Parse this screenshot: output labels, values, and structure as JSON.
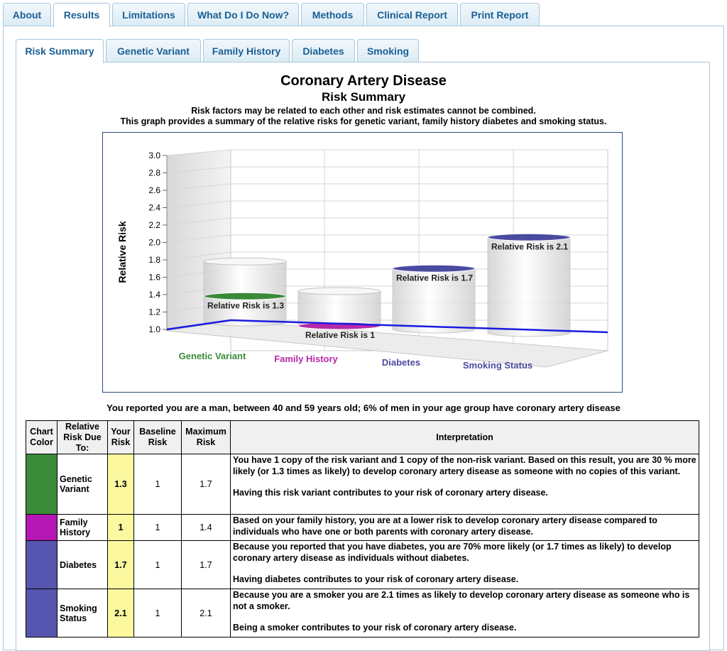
{
  "top_tabs": [
    {
      "label": "About"
    },
    {
      "label": "Results"
    },
    {
      "label": "Limitations"
    },
    {
      "label": "What Do I Do Now?"
    },
    {
      "label": "Methods"
    },
    {
      "label": "Clinical Report"
    },
    {
      "label": "Print Report"
    }
  ],
  "sub_tabs": [
    {
      "label": "Risk Summary"
    },
    {
      "label": "Genetic Variant"
    },
    {
      "label": "Family History"
    },
    {
      "label": "Diabetes"
    },
    {
      "label": "Smoking"
    }
  ],
  "header": {
    "title": "Coronary Artery Disease",
    "subtitle": "Risk Summary",
    "note1": "Risk factors may be related to each other and risk estimates cannot be combined.",
    "note2": "This graph provides a summary of the relative risks for genetic variant, family history diabetes and smoking status."
  },
  "chart_data": {
    "type": "bar",
    "ylabel": "Relative Risk",
    "ylim": [
      1.0,
      3.0
    ],
    "yticks": [
      "3.0",
      "2.8",
      "2.6",
      "2.4",
      "2.2",
      "2.0",
      "1.8",
      "1.6",
      "1.4",
      "1.2",
      "1.0"
    ],
    "baseline": 1.0,
    "categories": [
      "Genetic Variant",
      "Family History",
      "Diabetes",
      "Smoking Status"
    ],
    "values": [
      1.3,
      1,
      1.7,
      2.1
    ],
    "max_values": [
      1.7,
      1.4,
      1.7,
      2.1
    ],
    "data_labels": [
      "Relative Risk is 1.3",
      "Relative Risk is 1",
      "Relative Risk is 1.7",
      "Relative Risk is 2.1"
    ],
    "colors": [
      "#3a8a3a",
      "#b52aa8",
      "#4a4aa0",
      "#4a4aa0"
    ]
  },
  "report_line": "You reported you are a man, between 40 and 59 years old; 6% of men in your age group have coronary artery disease",
  "table": {
    "headers": [
      "Chart Color",
      "Relative Risk Due To:",
      "Your Risk",
      "Baseline Risk",
      "Maximum Risk",
      "Interpretation"
    ],
    "rows": [
      {
        "color": "#3a8a3a",
        "label": "Genetic Variant",
        "your": "1.3",
        "baseline": "1",
        "max": "1.7",
        "p1": "You have 1 copy of the risk variant and 1 copy of the non-risk variant. Based on this result, you are 30 % more likely (or 1.3 times as likely) to develop coronary artery disease as someone with no copies of this variant.",
        "p2": "Having this risk variant contributes to your risk of coronary artery disease."
      },
      {
        "color": "#b517b5",
        "label": "Family History",
        "your": "1",
        "baseline": "1",
        "max": "1.4",
        "p1": "Based on your family history, you are at a lower risk to develop coronary artery disease compared to individuals who have one or both parents with coronary artery disease.",
        "p2": ""
      },
      {
        "color": "#5656b0",
        "label": "Diabetes",
        "your": "1.7",
        "baseline": "1",
        "max": "1.7",
        "p1": "Because you reported that you have diabetes, you are 70% more likely (or 1.7 times as likely) to develop coronary artery disease as individuals without diabetes.",
        "p2": "Having diabetes contributes to your risk of coronary artery disease."
      },
      {
        "color": "#5656b0",
        "label": "Smoking Status",
        "your": "2.1",
        "baseline": "1",
        "max": "2.1",
        "p1": "Because you are a smoker you are 2.1 times as likely to develop coronary artery disease as someone who is not a smoker.",
        "p2": "Being a smoker contributes to your risk of coronary artery disease."
      }
    ]
  }
}
